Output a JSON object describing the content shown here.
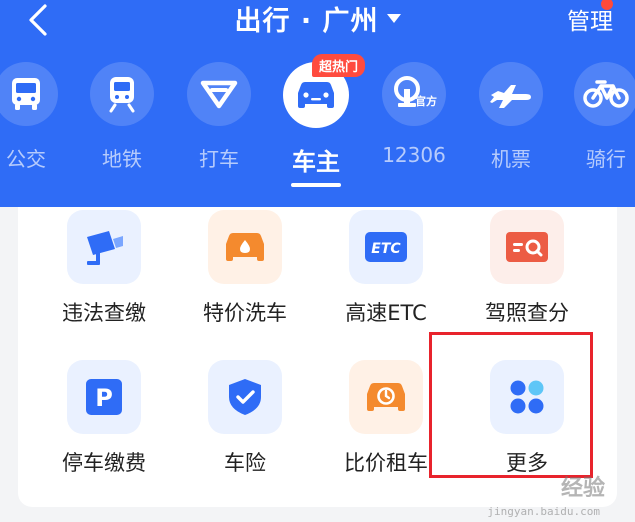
{
  "header": {
    "title": "出行 · 广州",
    "manage_label": "管理"
  },
  "transport": {
    "hot_badge": "超热门",
    "items": [
      {
        "label": "公交",
        "icon": "bus-icon"
      },
      {
        "label": "地铁",
        "icon": "metro-icon"
      },
      {
        "label": "打车",
        "icon": "taxi-icon"
      },
      {
        "label": "车主",
        "icon": "car-owner-icon",
        "active": true
      },
      {
        "label": "12306",
        "icon": "railway-icon",
        "badge_text": "官方"
      },
      {
        "label": "机票",
        "icon": "airplane-icon"
      },
      {
        "label": "骑行",
        "icon": "bicycle-icon"
      }
    ]
  },
  "services": [
    {
      "label": "违法查缴",
      "icon": "camera-violation-icon"
    },
    {
      "label": "特价洗车",
      "icon": "car-wash-icon"
    },
    {
      "label": "高速ETC",
      "icon": "etc-icon",
      "icon_text": "ETC"
    },
    {
      "label": "驾照查分",
      "icon": "license-search-icon"
    },
    {
      "label": "停车缴费",
      "icon": "parking-icon",
      "icon_text": "P"
    },
    {
      "label": "车险",
      "icon": "insurance-shield-icon"
    },
    {
      "label": "比价租车",
      "icon": "car-rental-icon"
    },
    {
      "label": "更多",
      "icon": "more-dots-icon"
    }
  ],
  "watermark": {
    "text": "经验",
    "url": "jingyan.baidu.com"
  },
  "colors": {
    "primary": "#2f6cf6",
    "accent_orange": "#f48a2e",
    "accent_red": "#ec5c44",
    "highlight": "#e8232c"
  }
}
